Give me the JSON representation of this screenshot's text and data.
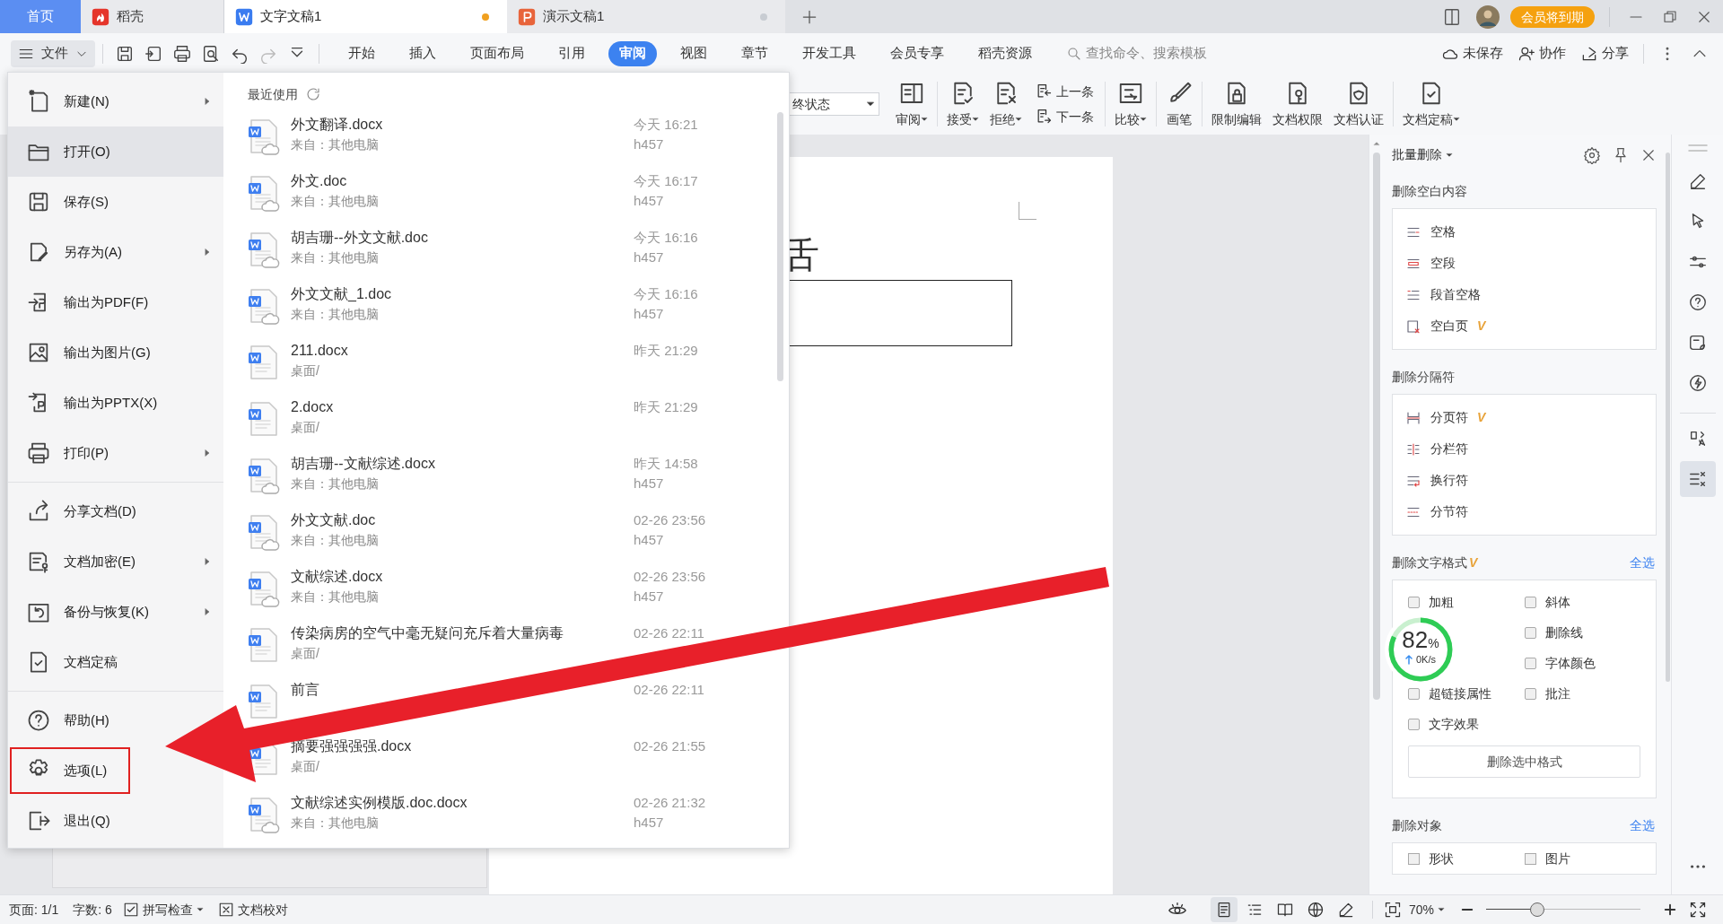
{
  "tabs": [
    {
      "label": "首页",
      "kind": "home",
      "selected": false
    },
    {
      "label": "稻壳",
      "kind": "docer",
      "selected": false
    },
    {
      "label": "文字文稿1",
      "kind": "writer",
      "selected": true,
      "color": "#f0a020"
    },
    {
      "label": "演示文稿1",
      "kind": "slides",
      "selected": false,
      "color": "#c8ccd2"
    }
  ],
  "title_bar": {
    "badge": "会员将到期"
  },
  "menu_bar": {
    "file_button": "文件",
    "ribbon_tabs": [
      {
        "label": "开始",
        "selected": false
      },
      {
        "label": "插入",
        "selected": false
      },
      {
        "label": "页面布局",
        "selected": false
      },
      {
        "label": "引用",
        "selected": false
      },
      {
        "label": "审阅",
        "selected": true
      },
      {
        "label": "视图",
        "selected": false
      },
      {
        "label": "章节",
        "selected": false
      },
      {
        "label": "开发工具",
        "selected": false
      },
      {
        "label": "会员专享",
        "selected": false
      },
      {
        "label": "稻壳资源",
        "selected": false
      }
    ],
    "search": {
      "placeholder": "查找命令、搜索模板"
    },
    "actions": [
      "未保存",
      "协作",
      "分享"
    ]
  },
  "ribbon": {
    "dropdown": "终状态",
    "buttons": [
      {
        "kind": "large",
        "label": "审阅",
        "dropdown": true
      },
      {
        "kind": "large",
        "label": "接受",
        "dropdown": true
      },
      {
        "kind": "large",
        "label": "拒绝",
        "dropdown": true
      },
      {
        "kind": "stack",
        "items": [
          "上一条",
          "下一条"
        ]
      },
      {
        "kind": "large",
        "label": "比较",
        "dropdown": true
      },
      {
        "kind": "large",
        "label": "画笔",
        "dropdown": false
      },
      {
        "kind": "large",
        "label": "限制编辑",
        "dropdown": false
      },
      {
        "kind": "large",
        "label": "文档权限",
        "dropdown": false
      },
      {
        "kind": "large",
        "label": "文档认证",
        "dropdown": false
      },
      {
        "kind": "large",
        "label": "文档定稿",
        "dropdown": true
      }
    ]
  },
  "file_menu": {
    "groups": [
      [
        {
          "label": "新建(N)",
          "submenu": true,
          "selected": false,
          "annotated": false
        },
        {
          "label": "打开(O)",
          "submenu": false,
          "selected": true,
          "annotated": false
        },
        {
          "label": "保存(S)",
          "submenu": false,
          "selected": false,
          "annotated": false
        },
        {
          "label": "另存为(A)",
          "submenu": true,
          "selected": false,
          "annotated": false
        },
        {
          "label": "输出为PDF(F)",
          "submenu": false,
          "selected": false,
          "annotated": false
        },
        {
          "label": "输出为图片(G)",
          "submenu": false,
          "selected": false,
          "annotated": false
        },
        {
          "label": "输出为PPTX(X)",
          "submenu": false,
          "selected": false,
          "annotated": false
        },
        {
          "label": "打印(P)",
          "submenu": true,
          "selected": false,
          "annotated": false
        }
      ],
      [
        {
          "label": "分享文档(D)",
          "submenu": false,
          "selected": false,
          "annotated": false
        },
        {
          "label": "文档加密(E)",
          "submenu": true,
          "selected": false,
          "annotated": false
        },
        {
          "label": "备份与恢复(K)",
          "submenu": true,
          "selected": false,
          "annotated": false
        },
        {
          "label": "文档定稿",
          "submenu": false,
          "selected": false,
          "annotated": false
        }
      ],
      [
        {
          "label": "帮助(H)",
          "submenu": false,
          "selected": false,
          "annotated": false
        },
        {
          "label": "选项(L)",
          "submenu": false,
          "selected": false,
          "annotated": true
        },
        {
          "label": "退出(Q)",
          "submenu": false,
          "selected": false,
          "annotated": false
        }
      ]
    ]
  },
  "recent": {
    "title": "最近使用",
    "files": [
      {
        "name": "外文翻译.docx",
        "source": "来自：其他电脑",
        "time": "今天 16:21",
        "user": "h457",
        "cloud": true
      },
      {
        "name": "外文.doc",
        "source": "来自：其他电脑",
        "time": "今天 16:17",
        "user": "h457",
        "cloud": true
      },
      {
        "name": "胡吉珊--外文文献.doc",
        "source": "来自：其他电脑",
        "time": "今天 16:16",
        "user": "h457",
        "cloud": true
      },
      {
        "name": "外文文献_1.doc",
        "source": "来自：其他电脑",
        "time": "今天 16:16",
        "user": "h457",
        "cloud": true
      },
      {
        "name": "211.docx",
        "source": "桌面/",
        "time": "昨天 21:29",
        "cloud": false
      },
      {
        "name": "2.docx",
        "source": "桌面/",
        "time": "昨天 21:29",
        "cloud": false
      },
      {
        "name": "胡吉珊--文献综述.docx",
        "source": "来自：其他电脑",
        "time": "昨天 14:58",
        "user": "h457",
        "cloud": true
      },
      {
        "name": "外文文献.doc",
        "source": "来自：其他电脑",
        "time": "02-26 23:56",
        "user": "h457",
        "cloud": true
      },
      {
        "name": "文献综述.docx",
        "source": "来自：其他电脑",
        "time": "02-26 23:56",
        "user": "h457",
        "cloud": true
      },
      {
        "name": "传染病房的空气中毫无疑问充斥着大量病毒",
        "source": "桌面/",
        "time": "02-26 22:11",
        "cloud": false
      },
      {
        "name": "前言",
        "time": "02-26 22:11",
        "cloud": false
      },
      {
        "name": "摘要强强强强.docx",
        "source": "桌面/",
        "time": "02-26 21:55",
        "cloud": false
      },
      {
        "name": "文献综述实例模版.doc.docx",
        "source": "来自：其他电脑",
        "time": "02-26 21:32",
        "user": "h457",
        "cloud": true
      }
    ]
  },
  "document": {
    "text": "舌"
  },
  "panel": {
    "title": "批量删除",
    "sections": [
      {
        "title": "删除空白内容",
        "kind": "list",
        "items": [
          {
            "label": "空格"
          },
          {
            "label": "空段"
          },
          {
            "label": "段首空格"
          },
          {
            "label": "空白页",
            "badge": "V"
          }
        ]
      },
      {
        "title": "删除分隔符",
        "kind": "list",
        "items": [
          {
            "label": "分页符",
            "badge": "V"
          },
          {
            "label": "分栏符"
          },
          {
            "label": "换行符"
          },
          {
            "label": "分节符"
          }
        ]
      },
      {
        "title": "删除文字格式",
        "badge": "V",
        "select_all": "全选",
        "kind": "checks",
        "rows": [
          {
            "left": {
              "label": "加粗",
              "checked": false
            },
            "right": {
              "label": "斜体",
              "checked": false
            }
          },
          {
            "right": {
              "label": "删除线",
              "checked": false
            }
          },
          {
            "right": {
              "label": "字体颜色",
              "checked": false
            }
          },
          {
            "left": {
              "label": "超链接属性",
              "checked": false
            },
            "right": {
              "label": "批注",
              "checked": false
            }
          },
          {
            "left": {
              "label": "文字效果",
              "checked": false
            }
          }
        ],
        "button": "删除选中格式"
      },
      {
        "title": "删除对象",
        "select_all": "全选",
        "kind": "cut",
        "items": [
          {
            "label": "形状",
            "checked": false
          },
          {
            "label": "图片",
            "checked": false
          }
        ]
      }
    ]
  },
  "side_tools": [
    {
      "selected": false
    },
    {
      "selected": false
    },
    {
      "selected": false
    },
    {
      "selected": false
    },
    {
      "selected": false
    },
    {
      "selected": false
    },
    {
      "selected": false
    },
    {
      "selected": true
    }
  ],
  "speed_widget": {
    "value": "82",
    "unit": "%",
    "rate": "0K/s",
    "level": 0.82
  },
  "status_bar": {
    "page": "页面: 1/1",
    "words": "字数: 6",
    "spell": "拼写检查",
    "proof": "文档校对",
    "zoom": "70%",
    "zoom_slider": {
      "level": 0.33
    }
  }
}
